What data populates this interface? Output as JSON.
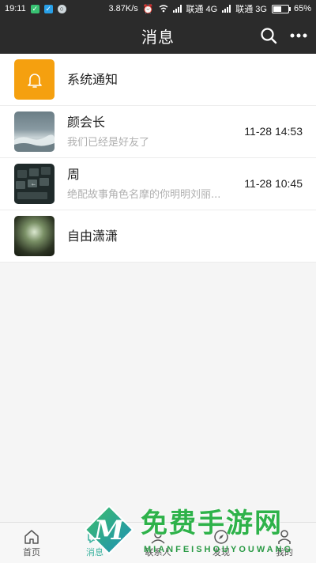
{
  "statusbar": {
    "time": "19:11",
    "speed": "3.87K/s",
    "carrier1": "联通 4G",
    "carrier2": "联通 3G",
    "battery": "65%",
    "battery_level": 0.65
  },
  "header": {
    "title": "消息",
    "search_icon": "search-icon",
    "more_icon": "more-icon"
  },
  "messages": [
    {
      "name": "系统通知",
      "preview": "",
      "time": ""
    },
    {
      "name": "颜会长",
      "preview": "我们已经是好友了",
      "time": "11-28 14:53"
    },
    {
      "name": "周",
      "preview": "绝配故事角色名摩的你明明刘丽...",
      "time": "11-28 10:45"
    },
    {
      "name": "自由潇潇",
      "preview": "",
      "time": ""
    }
  ],
  "nav": [
    {
      "label": "首页",
      "icon": "home-icon"
    },
    {
      "label": "消息",
      "icon": "message-icon"
    },
    {
      "label": "联系人",
      "icon": "contacts-icon"
    },
    {
      "label": "发现",
      "icon": "discover-icon"
    },
    {
      "label": "我的",
      "icon": "profile-icon"
    }
  ],
  "watermark": {
    "title": "免费手游网",
    "subtitle": "MIANFEISHOUYOUWANG"
  }
}
